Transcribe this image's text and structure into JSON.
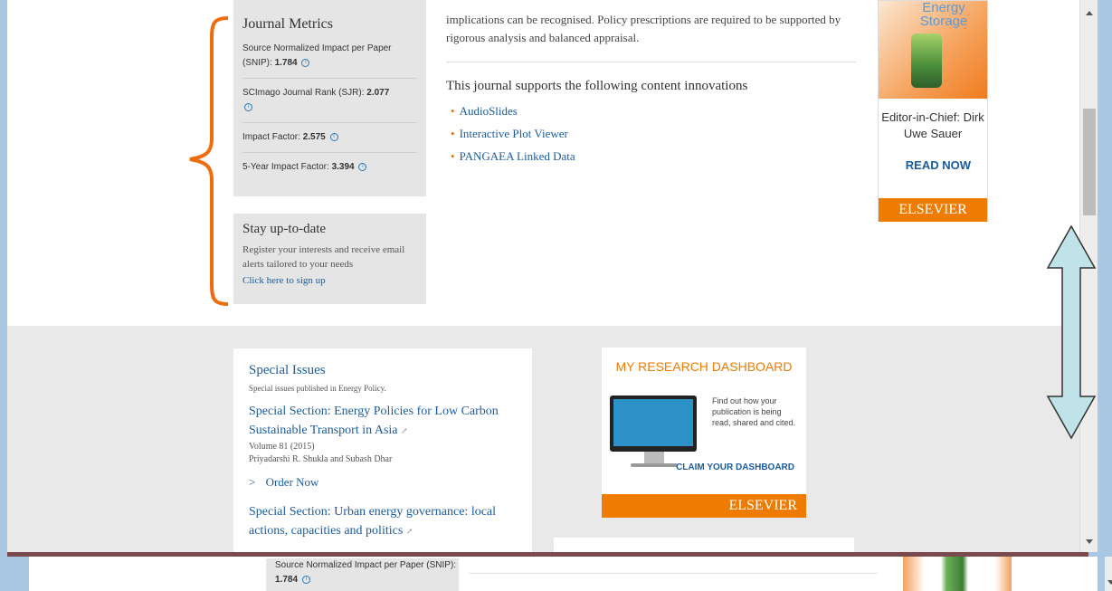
{
  "metrics": {
    "title": "Journal Metrics",
    "snip_label": "Source Normalized Impact per Paper (SNIP):",
    "snip_value": "1.784",
    "sjr_label": "SCImago Journal Rank (SJR):",
    "sjr_value": "2.077",
    "if_label": "Impact Factor:",
    "if_value": "2.575",
    "if5_label": "5-Year Impact Factor:",
    "if5_value": "3.394"
  },
  "stay": {
    "title": "Stay up-to-date",
    "text": "Register your interests and receive email alerts tailored to your needs",
    "link": "Click here to sign up"
  },
  "main": {
    "intro_text": "implications can be recognised. Policy prescriptions are required to be supported by rigorous analysis and balanced appraisal.",
    "innovations_title": "This journal supports the following content innovations",
    "innovations": [
      "AudioSlides",
      "Interactive Plot Viewer",
      "PANGAEA Linked Data"
    ]
  },
  "ad": {
    "product": "Energy Storage",
    "editor": "Editor-in-Chief: Dirk Uwe Sauer",
    "cta": "READ NOW",
    "brand": "ELSEVIER"
  },
  "special": {
    "title": "Special Issues",
    "subtitle": "Special issues published in Energy Policy.",
    "item1_title": "Special Section: Energy Policies for Low Carbon Sustainable Transport in Asia",
    "item1_volume": "Volume 81 (2015)",
    "item1_authors": "Priyadarshi R. Shukla and Subash Dhar",
    "order": "Order Now",
    "item2_title": "Special Section: Urban energy governance: local actions, capacities and politics"
  },
  "dashboard": {
    "title": "MY RESEARCH DASHBOARD",
    "text": "Find out how your publication is being read, shared and cited.",
    "cta": "CLAIM YOUR DASHBOARD",
    "brand": "ELSEVIER"
  },
  "bottom": {
    "snip_label": "Source Normalized Impact per Paper (SNIP):",
    "snip_value": "1.784"
  },
  "colors": {
    "annotation_brace": "#ef6c0e",
    "annotation_arrow": "#bfe3e8",
    "elsevier_orange": "#ef7c00",
    "link_blue": "#1a5c9e"
  }
}
